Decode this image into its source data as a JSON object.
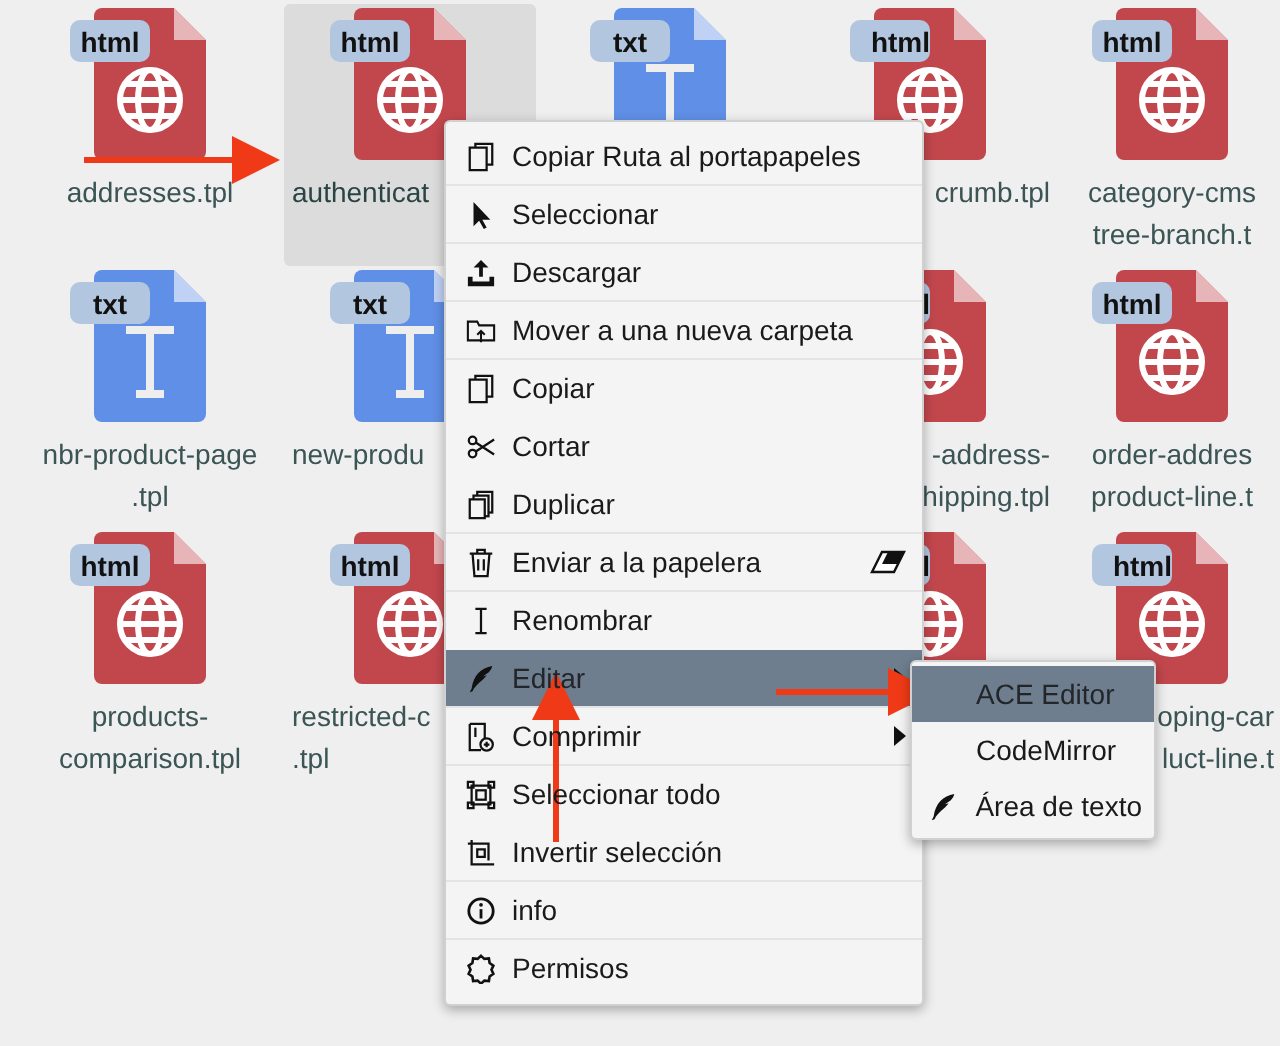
{
  "files": [
    [
      {
        "kind": "html",
        "badge": "html",
        "label": [
          "addresses.tpl"
        ],
        "selected": false
      },
      {
        "kind": "html",
        "badge": "html",
        "label": [
          "authenticat"
        ],
        "selected": true
      },
      {
        "kind": "txt",
        "badge": "txt",
        "selected": false
      },
      {
        "kind": "html",
        "badge": "html",
        "label": [
          "crumb.tpl"
        ],
        "selected": false
      },
      {
        "kind": "html",
        "badge": "html",
        "label": [
          "category-cms",
          "tree-branch.t"
        ],
        "selected": false
      }
    ],
    [
      {
        "kind": "txt",
        "badge": "txt",
        "label": [
          "nbr-product-page",
          ".tpl"
        ],
        "selected": false
      },
      {
        "kind": "txt",
        "badge": "txt",
        "label": [
          "new-produ"
        ],
        "selected": false
      },
      {
        "kind": "html",
        "badge": "l",
        "label": [
          "-address-",
          "hipping.tpl"
        ],
        "selected": false
      },
      {
        "kind": "html",
        "badge": "html",
        "label": [
          "order-addres",
          "product-line.t"
        ],
        "selected": false
      }
    ],
    [
      {
        "kind": "html",
        "badge": "html",
        "label": [
          "products-",
          "comparison.tpl"
        ],
        "selected": false
      },
      {
        "kind": "html",
        "badge": "html",
        "label": [
          "restricted-c",
          ".tpl"
        ],
        "selected": false
      },
      {
        "kind": "html",
        "badge": "l",
        "selected": false
      },
      {
        "kind": "html",
        "badge": "html",
        "label": [
          "oping-car",
          "luct-line.t"
        ],
        "selected": false
      }
    ]
  ],
  "menu": [
    {
      "kind": "copy",
      "label": "Copiar Ruta al portapapeles",
      "selected": false,
      "divider": true
    },
    {
      "kind": "pointer",
      "label": "Seleccionar",
      "selected": false,
      "divider": true
    },
    {
      "kind": "upload",
      "label": "Descargar",
      "selected": false,
      "divider": true
    },
    {
      "kind": "move",
      "label": "Mover a una nueva carpeta",
      "selected": false,
      "divider": true
    },
    {
      "kind": "copy",
      "label": "Copiar",
      "selected": false,
      "divider": false
    },
    {
      "kind": "scissors",
      "label": "Cortar",
      "selected": false,
      "divider": false
    },
    {
      "kind": "duplicate",
      "label": "Duplicar",
      "selected": false,
      "divider": true
    },
    {
      "kind": "trash",
      "label": "Enviar a la papelera",
      "selected": false,
      "divider": true,
      "has_submenu": false
    },
    {
      "kind": "cursor",
      "label": "Renombrar",
      "selected": false,
      "divider": false
    },
    {
      "kind": "feather",
      "label": "Editar",
      "selected": true,
      "divider": true,
      "has_submenu": true
    },
    {
      "kind": "archive",
      "label": "Comprimir",
      "selected": false,
      "divider": true,
      "has_submenu": true
    },
    {
      "kind": "selectall",
      "label": "Seleccionar todo",
      "selected": false,
      "divider": false
    },
    {
      "kind": "invert",
      "label": "Invertir selección",
      "selected": false,
      "divider": true
    },
    {
      "kind": "info",
      "label": "info",
      "selected": false,
      "divider": true
    },
    {
      "kind": "gear",
      "label": "Permisos",
      "selected": false,
      "divider": false
    }
  ],
  "submenu": [
    {
      "kind": "plain",
      "label": "ACE Editor",
      "selected": true
    },
    {
      "kind": "plain",
      "label": "CodeMirror",
      "selected": false
    },
    {
      "kind": "feather",
      "label": "Área de texto",
      "selected": false
    }
  ]
}
